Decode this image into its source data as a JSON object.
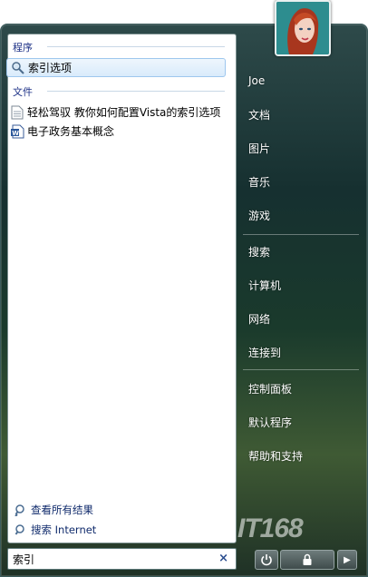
{
  "user": {
    "name": "Joe",
    "picture_icon": "user-avatar-woman"
  },
  "left_pane": {
    "programs_header": "程序",
    "programs": [
      {
        "label": "索引选项",
        "icon": "indexing-options-icon",
        "selected": true
      }
    ],
    "files_header": "文件",
    "files": [
      {
        "label": "轻松驾驭 教你如何配置Vista的索引选项",
        "icon": "text-document-icon"
      },
      {
        "label": "电子政务基本概念",
        "icon": "word-document-icon"
      }
    ],
    "see_all_results": "查看所有结果",
    "search_internet": "搜索 Internet"
  },
  "search": {
    "value": "索引",
    "clear": "×"
  },
  "right_pane": {
    "items": [
      {
        "label": "文档"
      },
      {
        "label": "图片"
      },
      {
        "label": "音乐"
      },
      {
        "label": "游戏"
      },
      {
        "label": "搜索"
      },
      {
        "label": "计算机"
      },
      {
        "label": "网络"
      },
      {
        "label": "连接到"
      },
      {
        "label": "控制面板"
      },
      {
        "label": "默认程序"
      },
      {
        "label": "帮助和支持"
      }
    ]
  },
  "footer": {
    "power_icon": "power-icon",
    "lock_icon": "lock-icon",
    "arrow": "▶"
  },
  "watermark": "IT168",
  "colors": {
    "selection": "#d9ebfb",
    "group_header": "#1e3287",
    "right_text": "#ffffff"
  }
}
